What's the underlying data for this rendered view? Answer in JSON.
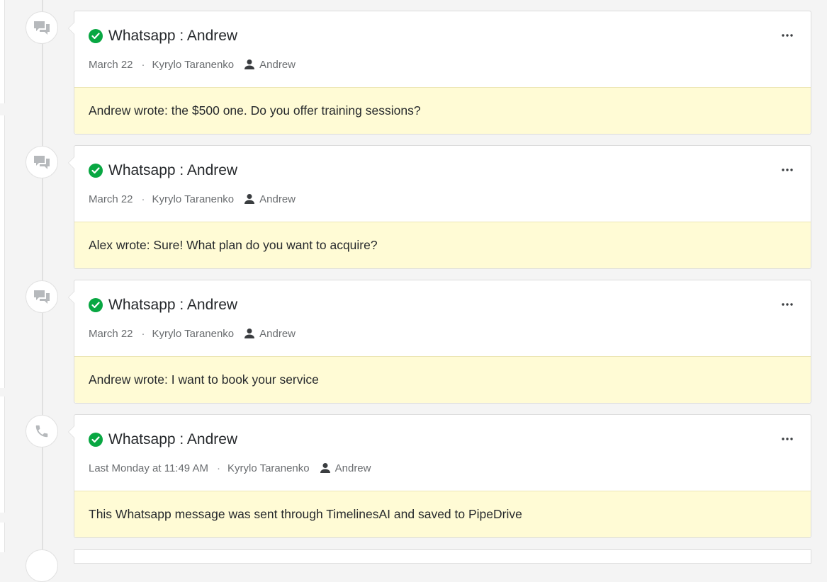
{
  "colors": {
    "success_check": "#08a742",
    "note_background": "#fffbd5",
    "page_background": "#f4f4f4"
  },
  "activities": [
    {
      "icon": "chat-icon",
      "title": "Whatsapp : Andrew",
      "date": "March 22",
      "owner": "Kyrylo Taranenko",
      "contact": "Andrew",
      "note": "Andrew wrote: the $500 one. Do you offer training sessions?"
    },
    {
      "icon": "chat-icon",
      "title": "Whatsapp : Andrew",
      "date": "March 22",
      "owner": "Kyrylo Taranenko",
      "contact": "Andrew",
      "note": "Alex wrote: Sure! What plan do you want to acquire?"
    },
    {
      "icon": "chat-icon",
      "title": "Whatsapp : Andrew",
      "date": "March 22",
      "owner": "Kyrylo Taranenko",
      "contact": "Andrew",
      "note": "Andrew wrote: I want to book your service"
    },
    {
      "icon": "phone-icon",
      "title": "Whatsapp : Andrew",
      "date": "Last Monday at 11:49 AM",
      "owner": "Kyrylo Taranenko",
      "contact": "Andrew",
      "note": "This Whatsapp message was sent through TimelinesAI and saved to PipeDrive"
    }
  ],
  "separator": "·"
}
